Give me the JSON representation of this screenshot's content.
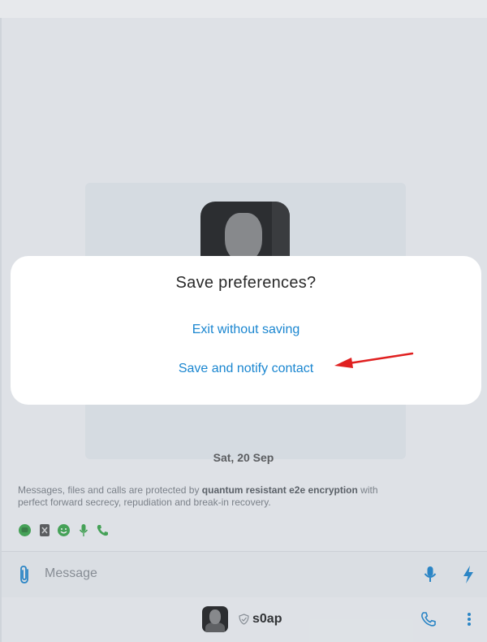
{
  "dialog": {
    "title": "Save preferences?",
    "exit_label": "Exit without saving",
    "save_label": "Save and notify contact"
  },
  "chat": {
    "date_separator": "Sat, 20 Sep",
    "e2e_notice": {
      "prefix": "Messages, files and calls are protected by ",
      "bold": "quantum resistant e2e encryption",
      "suffix": " with perfect forward secrecy, repudiation and break-in recovery."
    },
    "feature_icons": [
      "chat-bubble-icon",
      "timer-delete-icon",
      "emoji-icon",
      "microphone-icon",
      "phone-icon"
    ]
  },
  "composer": {
    "placeholder": "Message",
    "icons": [
      "paperclip-icon",
      "microphone-icon",
      "lightning-icon"
    ]
  },
  "contact_bar": {
    "name": "s0ap",
    "icons": [
      "shield-icon",
      "phone-icon",
      "more-vertical-icon"
    ]
  },
  "colors": {
    "accent": "#1a86d0",
    "annotation_arrow": "#e02020",
    "feature_icon_green": "#3aa84a"
  }
}
